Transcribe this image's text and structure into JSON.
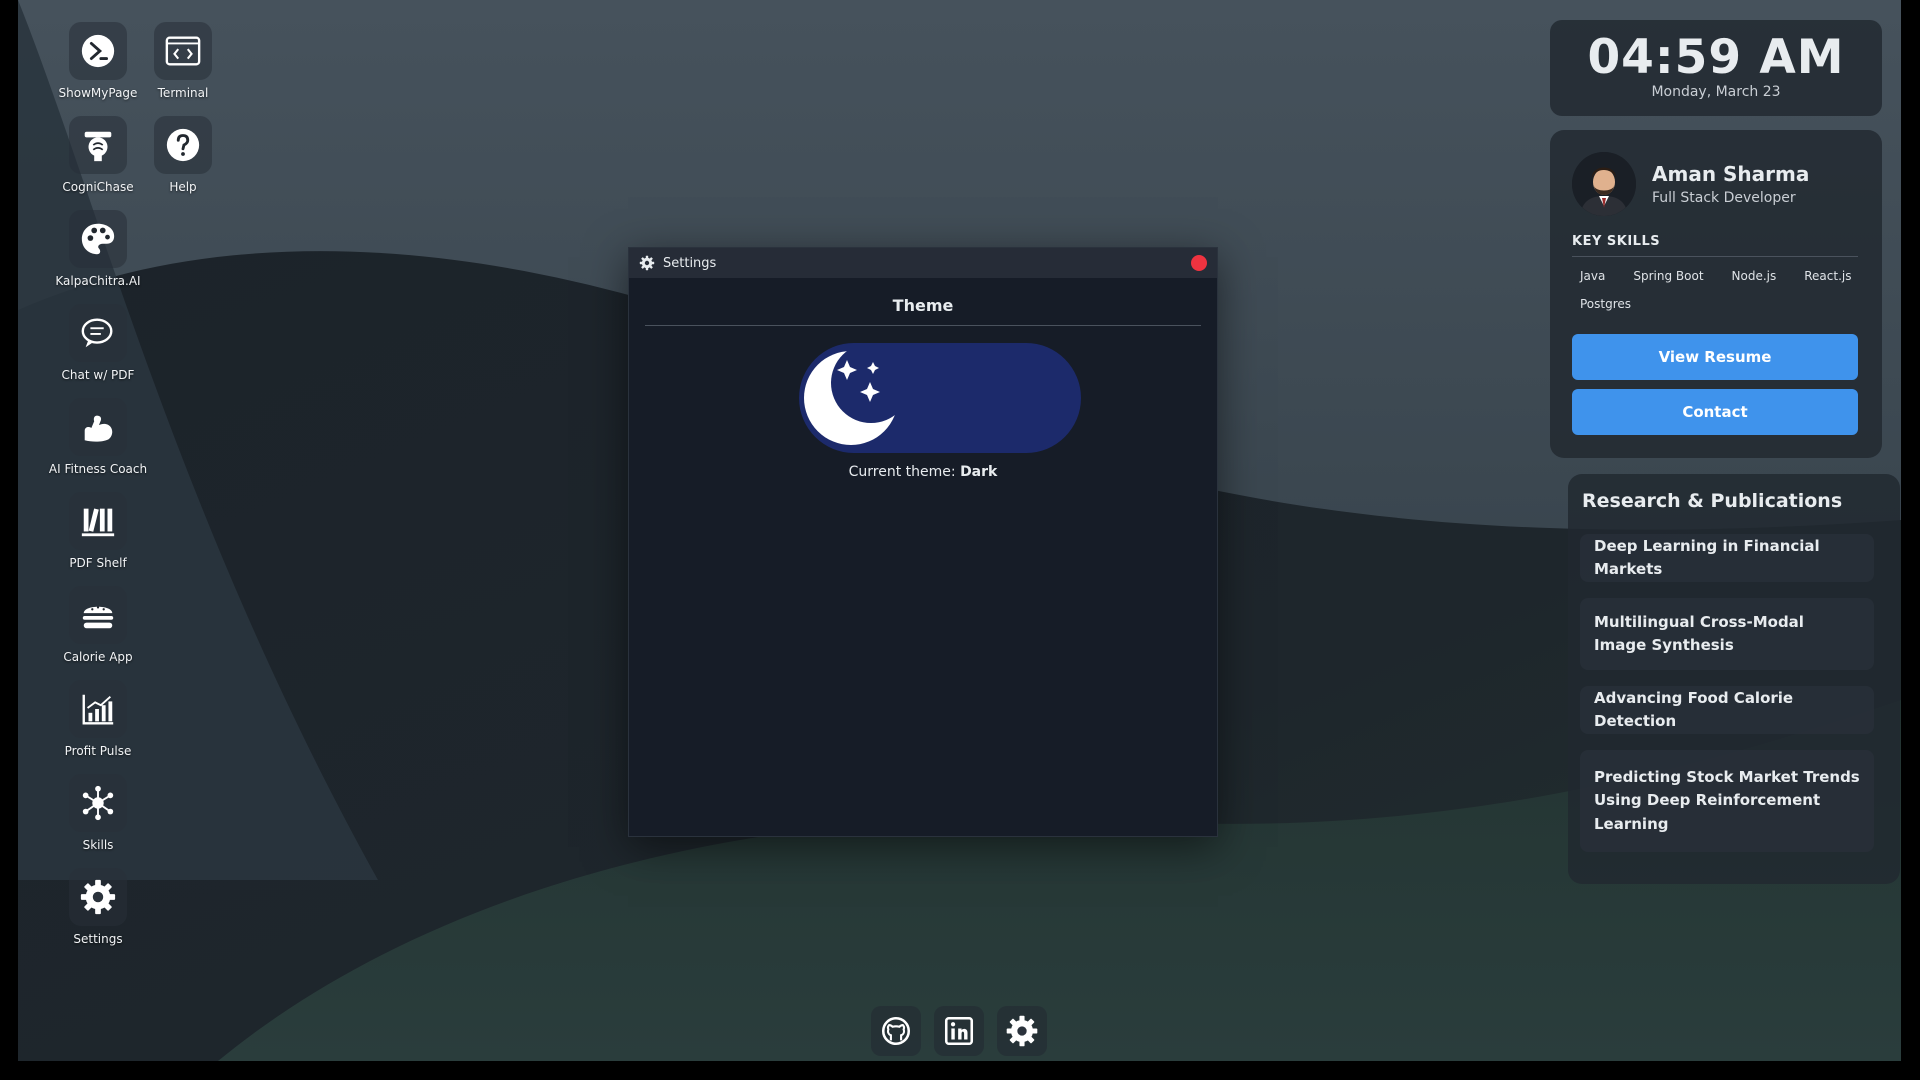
{
  "desktop_icons": [
    {
      "label": "ShowMyPage",
      "icon": "terminal-prompt-icon"
    },
    {
      "label": "Terminal",
      "icon": "code-window-icon"
    },
    {
      "label": "CogniChase",
      "icon": "robot-brain-icon"
    },
    {
      "label": "Help",
      "icon": "help-icon"
    },
    {
      "label": "KalpaChitra.AI",
      "icon": "palette-icon"
    },
    {
      "label": "Chat w/ PDF",
      "icon": "chat-icon"
    },
    {
      "label": "AI Fitness Coach",
      "icon": "flexed-arm-icon"
    },
    {
      "label": "PDF Shelf",
      "icon": "bookshelf-icon"
    },
    {
      "label": "Calorie App",
      "icon": "burger-icon"
    },
    {
      "label": "Profit Pulse",
      "icon": "chart-icon"
    },
    {
      "label": "Skills",
      "icon": "network-icon"
    },
    {
      "label": "Settings",
      "icon": "gear-icon"
    }
  ],
  "settings_window": {
    "title": "Settings",
    "heading": "Theme",
    "caption_prefix": "Current theme: ",
    "current_theme": "Dark",
    "toggle_color": "#1c2a6b",
    "close_color": "#ef3340"
  },
  "clock": {
    "time": "04:59 AM",
    "date": "Monday, March 23"
  },
  "profile": {
    "name": "Aman Sharma",
    "role": "Full Stack Developer",
    "skills_heading": "KEY SKILLS",
    "skills": [
      "Java",
      "Spring Boot",
      "Node.js",
      "React.js",
      "Postgres"
    ],
    "resume_label": "View Resume",
    "contact_label": "Contact",
    "accent": "#3f93ec"
  },
  "research": {
    "title": "Research & Publications",
    "items": [
      "Deep Learning in Financial Markets",
      "Multilingual Cross-Modal Image Synthesis",
      "Advancing Food Calorie Detection",
      "Predicting Stock Market Trends Using Deep Reinforcement Learning"
    ]
  },
  "dock": [
    {
      "icon": "github-icon"
    },
    {
      "icon": "linkedin-icon"
    },
    {
      "icon": "settings-gear-icon"
    }
  ]
}
